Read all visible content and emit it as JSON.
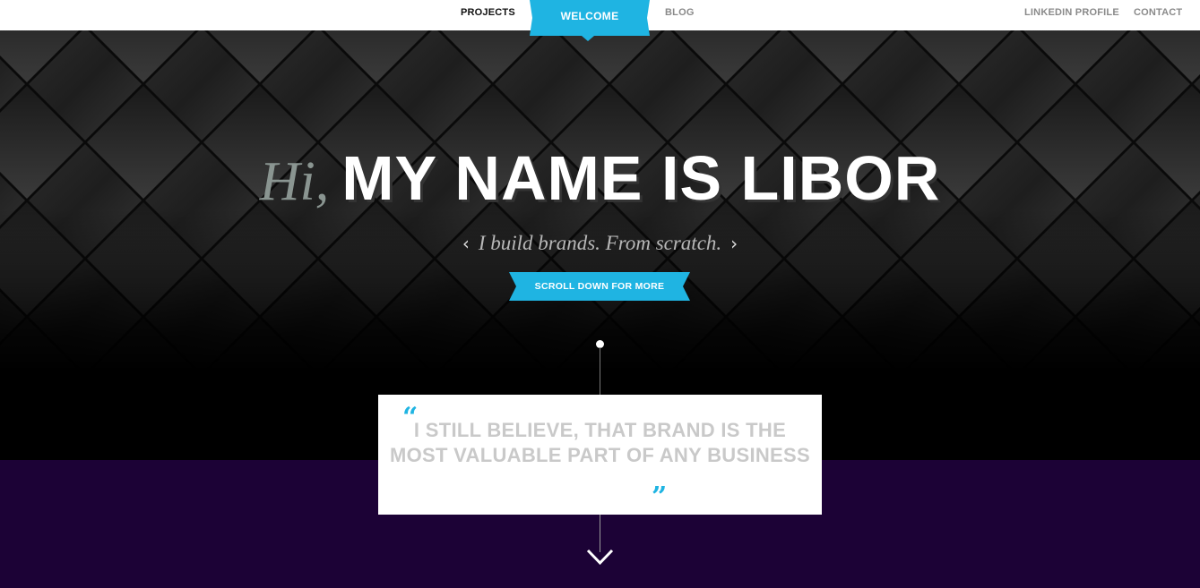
{
  "nav": {
    "projects": "PROJECTS",
    "welcome": "WELCOME",
    "blog": "BLOG",
    "linkedin": "LINKEDIN PROFILE",
    "contact": "CONTACT"
  },
  "hero": {
    "greeting": "Hi,",
    "name": "MY NAME IS LIBOR",
    "tagline": "I build brands. From scratch.",
    "chevron_left": "‹",
    "chevron_right": "›",
    "scroll_label": "SCROLL DOWN FOR MORE"
  },
  "quote": {
    "open_mark": "“",
    "text": "I STILL BELIEVE, THAT BRAND IS THE MOST VALUABLE PART OF ANY BUSINESS",
    "close_mark": "”"
  },
  "colors": {
    "accent": "#1fb4e2",
    "purple": "#1c0236",
    "background": "#000000"
  },
  "icons": {
    "down": "chevron-down-icon"
  }
}
